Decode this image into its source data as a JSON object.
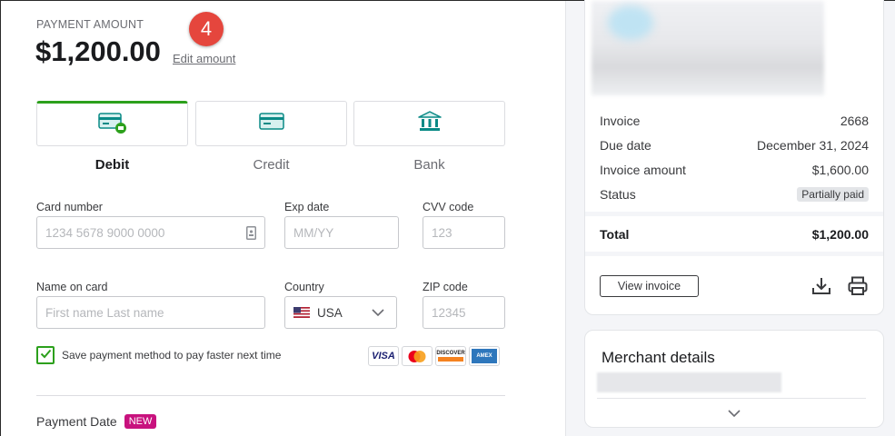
{
  "payment": {
    "label": "PAYMENT AMOUNT",
    "amount": "$1,200.00",
    "edit_label": "Edit amount",
    "step_number": "4"
  },
  "methods": {
    "debit": "Debit",
    "credit": "Credit",
    "bank": "Bank",
    "selected": "Debit"
  },
  "form": {
    "card_number_label": "Card number",
    "card_number_placeholder": "1234 5678 9000 0000",
    "exp_label": "Exp date",
    "exp_placeholder": "MM/YY",
    "cvv_label": "CVV code",
    "cvv_placeholder": "123",
    "name_label": "Name on card",
    "name_placeholder": "First name Last name",
    "country_label": "Country",
    "country_value": "USA",
    "zip_label": "ZIP code",
    "zip_placeholder": "12345",
    "save_label": "Save payment method to pay faster next time",
    "save_checked": true
  },
  "card_brands": [
    "VISA",
    "Mastercard",
    "DISCOVER",
    "AMEX"
  ],
  "payment_date": {
    "label": "Payment Date",
    "badge": "NEW"
  },
  "invoice": {
    "rows": [
      {
        "label": "Invoice",
        "value": "2668"
      },
      {
        "label": "Due date",
        "value": "December 31, 2024"
      },
      {
        "label": "Invoice amount",
        "value": "$1,600.00"
      },
      {
        "label": "Status",
        "value": "Partially paid"
      }
    ],
    "total_label": "Total",
    "total_value": "$1,200.00",
    "view_button": "View invoice"
  },
  "merchant": {
    "title": "Merchant details"
  },
  "colors": {
    "accent_green": "#2ca01c",
    "step_badge": "#e5463d",
    "new_badge": "#c8127e"
  }
}
